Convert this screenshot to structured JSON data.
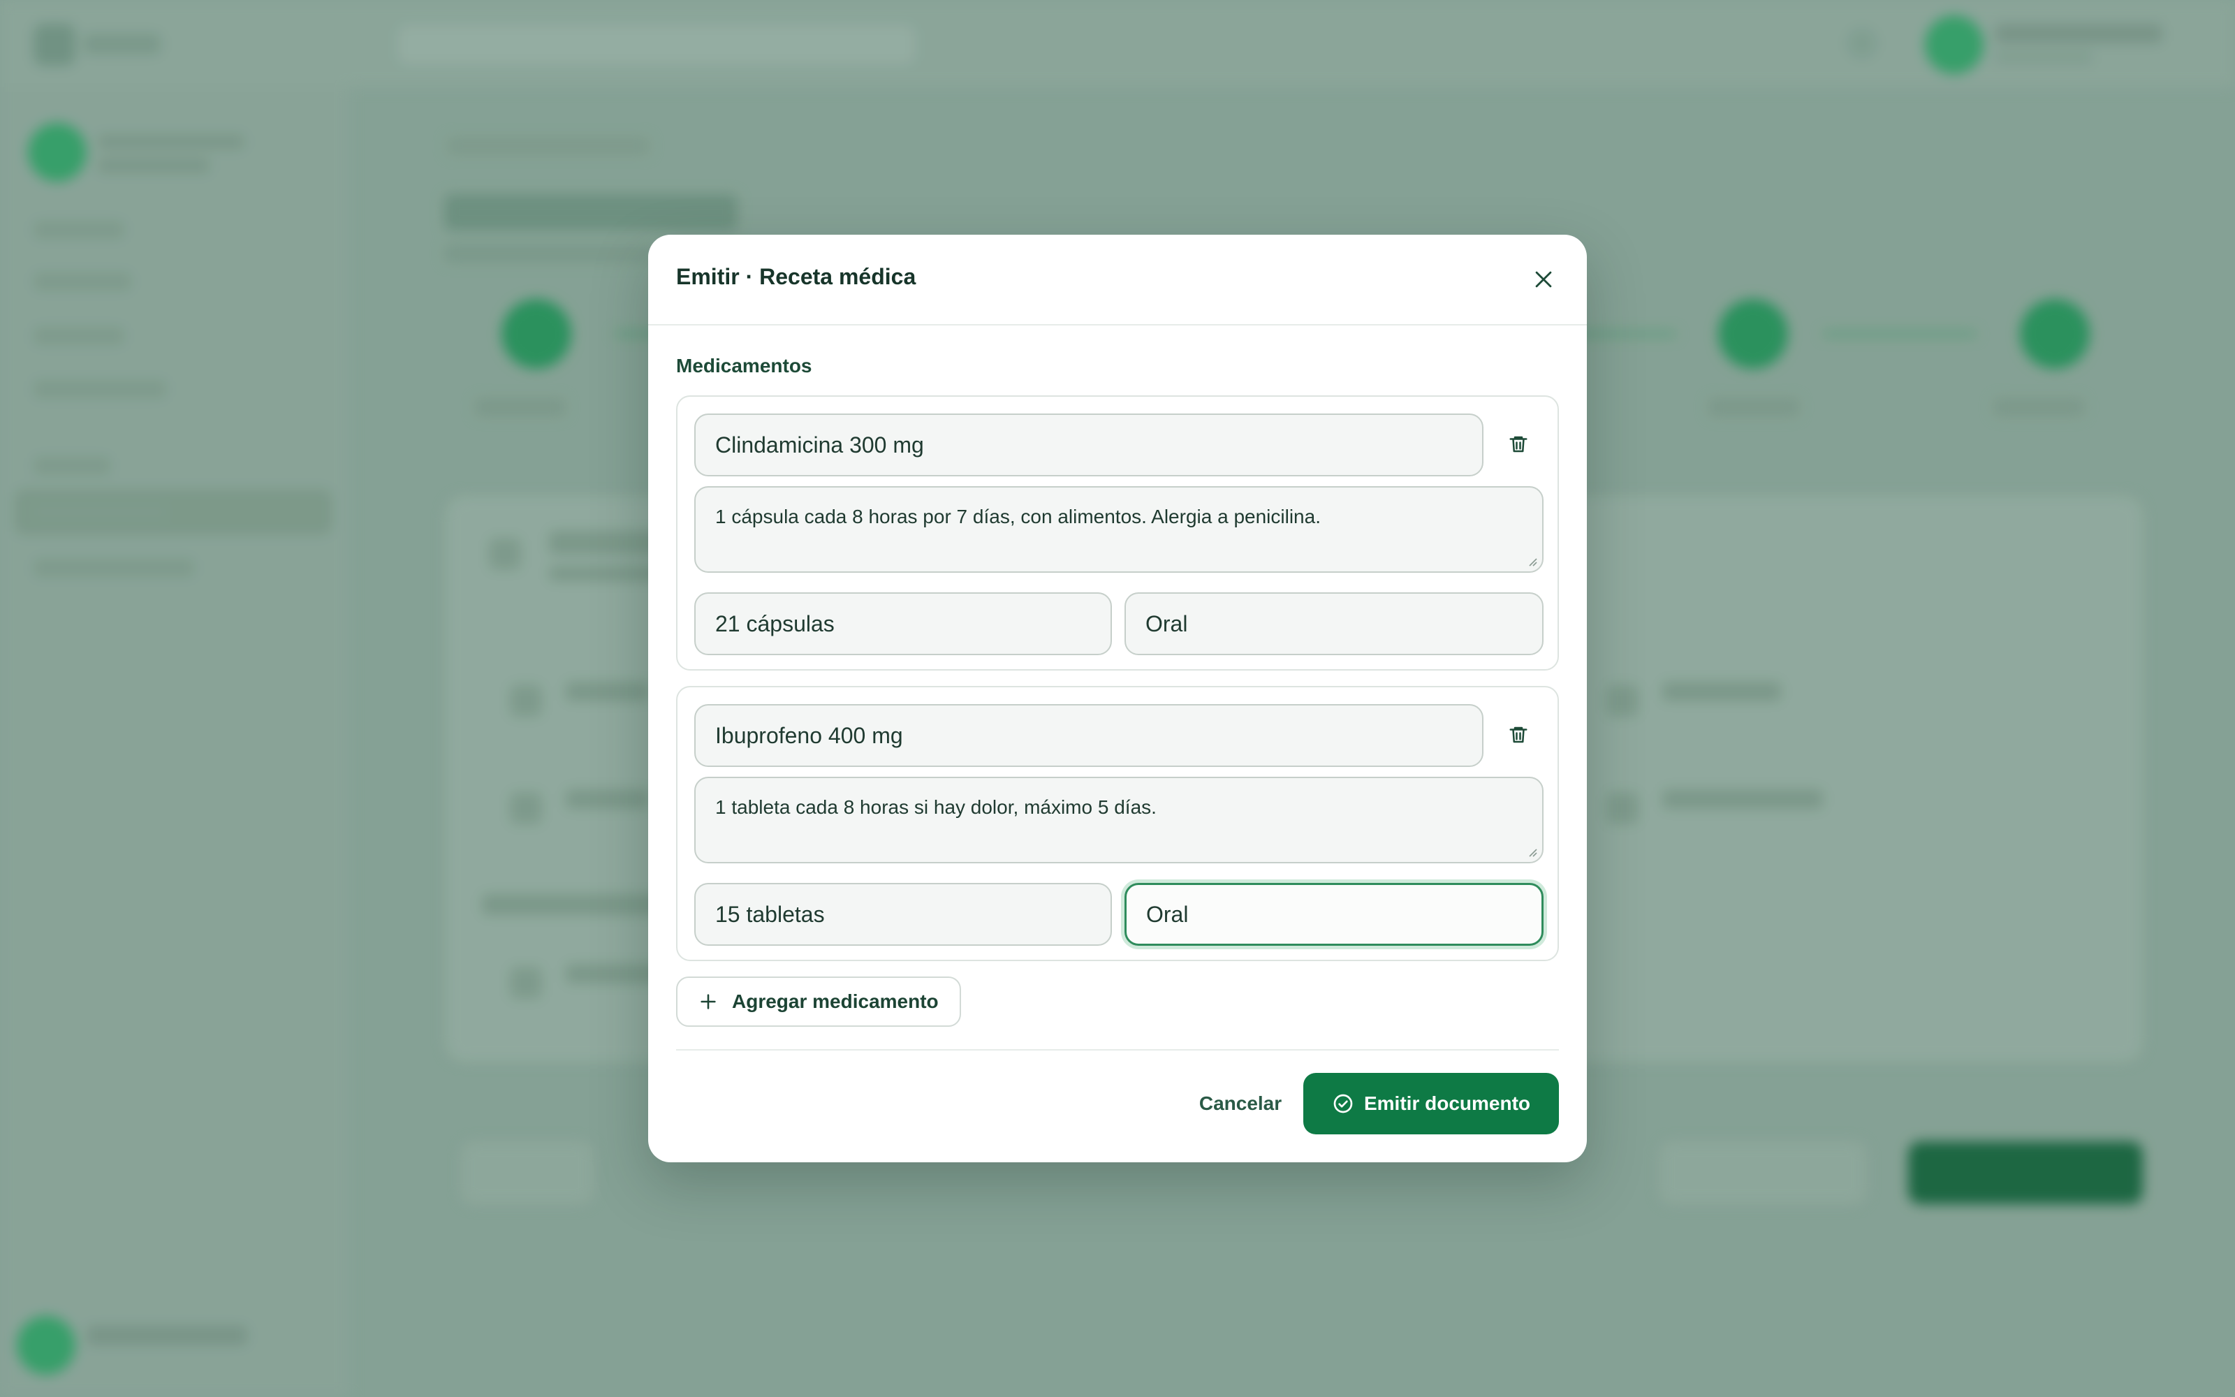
{
  "modal": {
    "title": "Emitir · Receta médica",
    "section_label": "Medicamentos",
    "medications": [
      {
        "name": "Clindamicina 300 mg",
        "instructions": "1 cápsula cada 8 horas por 7 días, con alimentos. Alergia a penicilina.",
        "quantity": "21 cápsulas",
        "route": "Oral"
      },
      {
        "name": "Ibuprofeno 400 mg",
        "instructions": "1 tableta cada 8 horas si hay dolor, máximo 5 días.",
        "quantity": "15 tabletas",
        "route": "Oral"
      }
    ],
    "add_button": "Agregar medicamento",
    "cancel_button": "Cancelar",
    "emit_button": "Emitir documento"
  },
  "icons": {
    "close": "close-icon",
    "delete": "trash-icon",
    "add": "plus-icon",
    "confirm": "check-circle-icon"
  },
  "colors": {
    "primary": "#0e7a45",
    "focus": "#2f8c5c",
    "text": "#17352a"
  }
}
